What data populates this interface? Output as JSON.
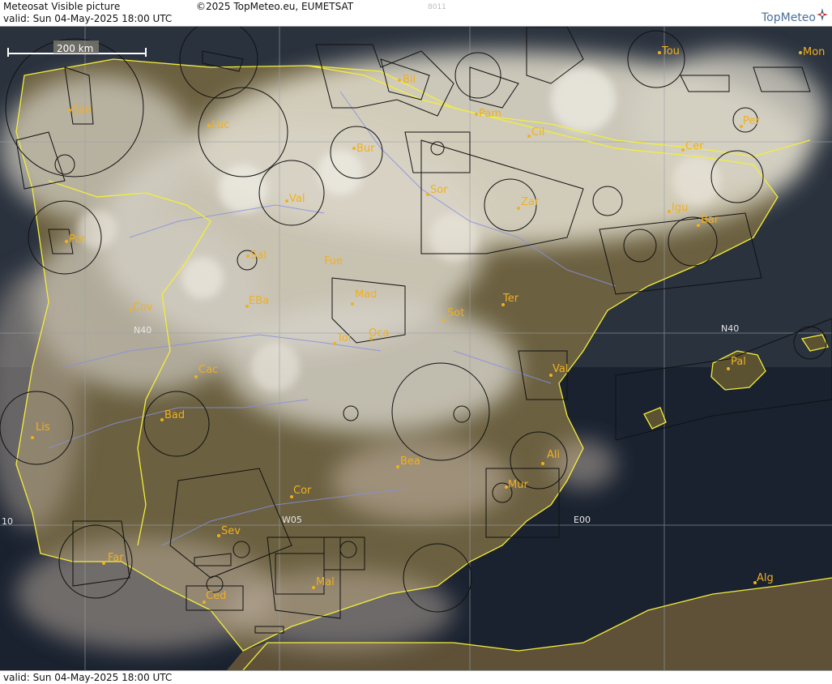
{
  "header": {
    "title": "Meteosat Visible picture",
    "valid": "valid:  Sun  04-May-2025  18:00 UTC",
    "copyright": "©2025 TopMeteo.eu, EUMETSAT",
    "code": "8011",
    "brand": "TopMeteo"
  },
  "footer": {
    "valid": "valid:  Sun  04-May-2025  18:00 UTC"
  },
  "map": {
    "scale_label": "200 km",
    "grid_labels": [
      "N40",
      "N40",
      "W05",
      "E00",
      "10"
    ],
    "cities": [
      "Bil",
      "Tou",
      "Mon",
      "San",
      "Luc",
      "Pam",
      "Cil",
      "Per",
      "Bur",
      "Cer",
      "Sor",
      "Val",
      "Zar",
      "Igu",
      "Bar",
      "Por",
      "Sal",
      "Fue",
      "Mad",
      "Cov",
      "EBa",
      "Sot",
      "Ter",
      "Tol",
      "Oca",
      "Cac",
      "Val",
      "Pal",
      "Lis",
      "Bad",
      "Bea",
      "Ali",
      "Mur",
      "Cor",
      "Sev",
      "Far",
      "Mal",
      "Ced",
      "Alg"
    ]
  },
  "colors": {
    "sea": "#1a2230",
    "land": "#6b6040",
    "cloud": "#ddd8c8",
    "border": "#f4ee3a",
    "river": "#8890e0",
    "city": "#f0b020",
    "airspace": "#111111"
  }
}
